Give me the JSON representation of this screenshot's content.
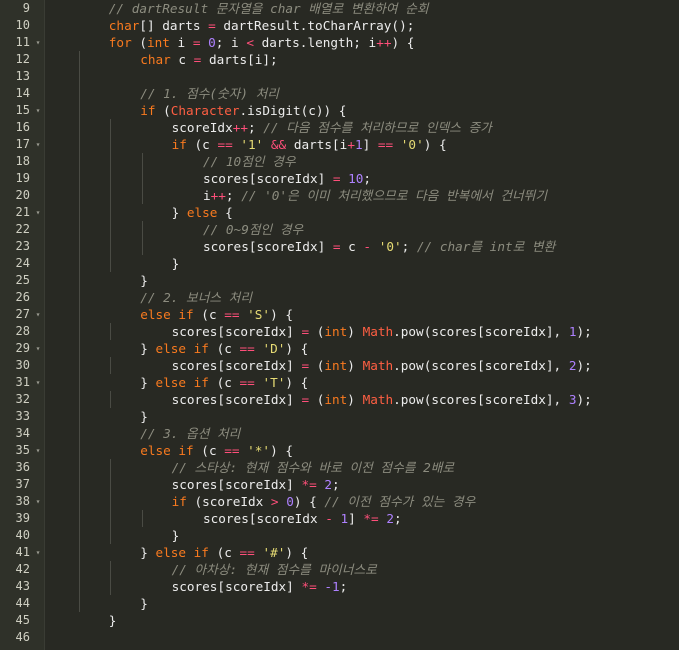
{
  "colors": {
    "background": "#282923",
    "gutter": "#2f3129",
    "line_number": "#cfcfc2",
    "comment": "#8c8c7f",
    "keyword": "#f97a1f",
    "operator": "#ff4f7a",
    "string": "#e6db74",
    "number": "#ae81ff",
    "class_name": "#ff5f43",
    "plain": "#ececec"
  },
  "editor": {
    "lines": [
      {
        "num": "9",
        "fold": "",
        "indent": 2,
        "tokens": [
          {
            "t": "// dartResult 문자열을 char 배열로 변환하여 순회",
            "k": "comment"
          }
        ]
      },
      {
        "num": "10",
        "fold": "",
        "indent": 2,
        "tokens": [
          {
            "t": "char",
            "k": "keyword"
          },
          {
            "t": "[] darts ",
            "k": "plain"
          },
          {
            "t": "=",
            "k": "operator"
          },
          {
            "t": " dartResult.toCharArray();",
            "k": "plain"
          }
        ]
      },
      {
        "num": "11",
        "fold": "▾",
        "indent": 2,
        "tokens": [
          {
            "t": "for",
            "k": "keyword"
          },
          {
            "t": " (",
            "k": "plain"
          },
          {
            "t": "int",
            "k": "keyword"
          },
          {
            "t": " i ",
            "k": "plain"
          },
          {
            "t": "=",
            "k": "operator"
          },
          {
            "t": " ",
            "k": "plain"
          },
          {
            "t": "0",
            "k": "number"
          },
          {
            "t": "; i ",
            "k": "plain"
          },
          {
            "t": "<",
            "k": "operator"
          },
          {
            "t": " darts.length; i",
            "k": "plain"
          },
          {
            "t": "++",
            "k": "operator"
          },
          {
            "t": ") {",
            "k": "plain"
          }
        ]
      },
      {
        "num": "12",
        "fold": "",
        "indent": 3,
        "tokens": [
          {
            "t": "char",
            "k": "keyword"
          },
          {
            "t": " c ",
            "k": "plain"
          },
          {
            "t": "=",
            "k": "operator"
          },
          {
            "t": " darts[i];",
            "k": "plain"
          }
        ]
      },
      {
        "num": "13",
        "fold": "",
        "indent": 3,
        "tokens": []
      },
      {
        "num": "14",
        "fold": "",
        "indent": 3,
        "tokens": [
          {
            "t": "// 1. 점수(숫자) 처리",
            "k": "comment"
          }
        ]
      },
      {
        "num": "15",
        "fold": "▾",
        "indent": 3,
        "tokens": [
          {
            "t": "if",
            "k": "keyword"
          },
          {
            "t": " (",
            "k": "plain"
          },
          {
            "t": "Character",
            "k": "class"
          },
          {
            "t": ".isDigit(c)) {",
            "k": "plain"
          }
        ]
      },
      {
        "num": "16",
        "fold": "",
        "indent": 4,
        "tokens": [
          {
            "t": "scoreIdx",
            "k": "plain"
          },
          {
            "t": "++",
            "k": "operator"
          },
          {
            "t": "; ",
            "k": "plain"
          },
          {
            "t": "// 다음 점수를 처리하므로 인덱스 증가",
            "k": "comment"
          }
        ]
      },
      {
        "num": "17",
        "fold": "▾",
        "indent": 4,
        "tokens": [
          {
            "t": "if",
            "k": "keyword"
          },
          {
            "t": " (c ",
            "k": "plain"
          },
          {
            "t": "==",
            "k": "operator"
          },
          {
            "t": " ",
            "k": "plain"
          },
          {
            "t": "'1'",
            "k": "string"
          },
          {
            "t": " ",
            "k": "plain"
          },
          {
            "t": "&&",
            "k": "operator"
          },
          {
            "t": " darts[i",
            "k": "plain"
          },
          {
            "t": "+",
            "k": "operator"
          },
          {
            "t": "1",
            "k": "number"
          },
          {
            "t": "] ",
            "k": "plain"
          },
          {
            "t": "==",
            "k": "operator"
          },
          {
            "t": " ",
            "k": "plain"
          },
          {
            "t": "'0'",
            "k": "string"
          },
          {
            "t": ") {",
            "k": "plain"
          }
        ]
      },
      {
        "num": "18",
        "fold": "",
        "indent": 5,
        "tokens": [
          {
            "t": "// 10점인 경우",
            "k": "comment"
          }
        ]
      },
      {
        "num": "19",
        "fold": "",
        "indent": 5,
        "tokens": [
          {
            "t": "scores[scoreIdx] ",
            "k": "plain"
          },
          {
            "t": "=",
            "k": "operator"
          },
          {
            "t": " ",
            "k": "plain"
          },
          {
            "t": "10",
            "k": "number"
          },
          {
            "t": ";",
            "k": "plain"
          }
        ]
      },
      {
        "num": "20",
        "fold": "",
        "indent": 5,
        "tokens": [
          {
            "t": "i",
            "k": "plain"
          },
          {
            "t": "++",
            "k": "operator"
          },
          {
            "t": "; ",
            "k": "plain"
          },
          {
            "t": "// '0'은 이미 처리했으므로 다음 반복에서 건너뛰기",
            "k": "comment"
          }
        ]
      },
      {
        "num": "21",
        "fold": "▾",
        "indent": 4,
        "tokens": [
          {
            "t": "} ",
            "k": "plain"
          },
          {
            "t": "else",
            "k": "keyword"
          },
          {
            "t": " {",
            "k": "plain"
          }
        ]
      },
      {
        "num": "22",
        "fold": "",
        "indent": 5,
        "tokens": [
          {
            "t": "// 0~9점인 경우",
            "k": "comment"
          }
        ]
      },
      {
        "num": "23",
        "fold": "",
        "indent": 5,
        "tokens": [
          {
            "t": "scores[scoreIdx] ",
            "k": "plain"
          },
          {
            "t": "=",
            "k": "operator"
          },
          {
            "t": " c ",
            "k": "plain"
          },
          {
            "t": "-",
            "k": "operator"
          },
          {
            "t": " ",
            "k": "plain"
          },
          {
            "t": "'0'",
            "k": "string"
          },
          {
            "t": "; ",
            "k": "plain"
          },
          {
            "t": "// char를 int로 변환",
            "k": "comment"
          }
        ]
      },
      {
        "num": "24",
        "fold": "",
        "indent": 4,
        "tokens": [
          {
            "t": "}",
            "k": "plain"
          }
        ]
      },
      {
        "num": "25",
        "fold": "",
        "indent": 3,
        "tokens": [
          {
            "t": "}",
            "k": "plain"
          }
        ]
      },
      {
        "num": "26",
        "fold": "",
        "indent": 3,
        "tokens": [
          {
            "t": "// 2. 보너스 처리",
            "k": "comment"
          }
        ]
      },
      {
        "num": "27",
        "fold": "▾",
        "indent": 3,
        "tokens": [
          {
            "t": "else",
            "k": "keyword"
          },
          {
            "t": " ",
            "k": "plain"
          },
          {
            "t": "if",
            "k": "keyword"
          },
          {
            "t": " (c ",
            "k": "plain"
          },
          {
            "t": "==",
            "k": "operator"
          },
          {
            "t": " ",
            "k": "plain"
          },
          {
            "t": "'S'",
            "k": "string"
          },
          {
            "t": ") {",
            "k": "plain"
          }
        ]
      },
      {
        "num": "28",
        "fold": "",
        "indent": 4,
        "tokens": [
          {
            "t": "scores[scoreIdx] ",
            "k": "plain"
          },
          {
            "t": "=",
            "k": "operator"
          },
          {
            "t": " (",
            "k": "plain"
          },
          {
            "t": "int",
            "k": "keyword"
          },
          {
            "t": ") ",
            "k": "plain"
          },
          {
            "t": "Math",
            "k": "class"
          },
          {
            "t": ".pow(scores[scoreIdx], ",
            "k": "plain"
          },
          {
            "t": "1",
            "k": "number"
          },
          {
            "t": ");",
            "k": "plain"
          }
        ]
      },
      {
        "num": "29",
        "fold": "▾",
        "indent": 3,
        "tokens": [
          {
            "t": "} ",
            "k": "plain"
          },
          {
            "t": "else",
            "k": "keyword"
          },
          {
            "t": " ",
            "k": "plain"
          },
          {
            "t": "if",
            "k": "keyword"
          },
          {
            "t": " (c ",
            "k": "plain"
          },
          {
            "t": "==",
            "k": "operator"
          },
          {
            "t": " ",
            "k": "plain"
          },
          {
            "t": "'D'",
            "k": "string"
          },
          {
            "t": ") {",
            "k": "plain"
          }
        ]
      },
      {
        "num": "30",
        "fold": "",
        "indent": 4,
        "tokens": [
          {
            "t": "scores[scoreIdx] ",
            "k": "plain"
          },
          {
            "t": "=",
            "k": "operator"
          },
          {
            "t": " (",
            "k": "plain"
          },
          {
            "t": "int",
            "k": "keyword"
          },
          {
            "t": ") ",
            "k": "plain"
          },
          {
            "t": "Math",
            "k": "class"
          },
          {
            "t": ".pow(scores[scoreIdx], ",
            "k": "plain"
          },
          {
            "t": "2",
            "k": "number"
          },
          {
            "t": ");",
            "k": "plain"
          }
        ]
      },
      {
        "num": "31",
        "fold": "▾",
        "indent": 3,
        "tokens": [
          {
            "t": "} ",
            "k": "plain"
          },
          {
            "t": "else",
            "k": "keyword"
          },
          {
            "t": " ",
            "k": "plain"
          },
          {
            "t": "if",
            "k": "keyword"
          },
          {
            "t": " (c ",
            "k": "plain"
          },
          {
            "t": "==",
            "k": "operator"
          },
          {
            "t": " ",
            "k": "plain"
          },
          {
            "t": "'T'",
            "k": "string"
          },
          {
            "t": ") {",
            "k": "plain"
          }
        ]
      },
      {
        "num": "32",
        "fold": "",
        "indent": 4,
        "tokens": [
          {
            "t": "scores[scoreIdx] ",
            "k": "plain"
          },
          {
            "t": "=",
            "k": "operator"
          },
          {
            "t": " (",
            "k": "plain"
          },
          {
            "t": "int",
            "k": "keyword"
          },
          {
            "t": ") ",
            "k": "plain"
          },
          {
            "t": "Math",
            "k": "class"
          },
          {
            "t": ".pow(scores[scoreIdx], ",
            "k": "plain"
          },
          {
            "t": "3",
            "k": "number"
          },
          {
            "t": ");",
            "k": "plain"
          }
        ]
      },
      {
        "num": "33",
        "fold": "",
        "indent": 3,
        "tokens": [
          {
            "t": "}",
            "k": "plain"
          }
        ]
      },
      {
        "num": "34",
        "fold": "",
        "indent": 3,
        "tokens": [
          {
            "t": "// 3. 옵션 처리",
            "k": "comment"
          }
        ]
      },
      {
        "num": "35",
        "fold": "▾",
        "indent": 3,
        "tokens": [
          {
            "t": "else",
            "k": "keyword"
          },
          {
            "t": " ",
            "k": "plain"
          },
          {
            "t": "if",
            "k": "keyword"
          },
          {
            "t": " (c ",
            "k": "plain"
          },
          {
            "t": "==",
            "k": "operator"
          },
          {
            "t": " ",
            "k": "plain"
          },
          {
            "t": "'*'",
            "k": "string"
          },
          {
            "t": ") {",
            "k": "plain"
          }
        ]
      },
      {
        "num": "36",
        "fold": "",
        "indent": 4,
        "tokens": [
          {
            "t": "// 스타상: 현재 점수와 바로 이전 점수를 2배로",
            "k": "comment"
          }
        ]
      },
      {
        "num": "37",
        "fold": "",
        "indent": 4,
        "tokens": [
          {
            "t": "scores[scoreIdx] ",
            "k": "plain"
          },
          {
            "t": "*=",
            "k": "operator"
          },
          {
            "t": " ",
            "k": "plain"
          },
          {
            "t": "2",
            "k": "number"
          },
          {
            "t": ";",
            "k": "plain"
          }
        ]
      },
      {
        "num": "38",
        "fold": "▾",
        "indent": 4,
        "tokens": [
          {
            "t": "if",
            "k": "keyword"
          },
          {
            "t": " (scoreIdx ",
            "k": "plain"
          },
          {
            "t": ">",
            "k": "operator"
          },
          {
            "t": " ",
            "k": "plain"
          },
          {
            "t": "0",
            "k": "number"
          },
          {
            "t": ") { ",
            "k": "plain"
          },
          {
            "t": "// 이전 점수가 있는 경우",
            "k": "comment"
          }
        ]
      },
      {
        "num": "39",
        "fold": "",
        "indent": 5,
        "tokens": [
          {
            "t": "scores[scoreIdx ",
            "k": "plain"
          },
          {
            "t": "-",
            "k": "operator"
          },
          {
            "t": " ",
            "k": "plain"
          },
          {
            "t": "1",
            "k": "number"
          },
          {
            "t": "] ",
            "k": "plain"
          },
          {
            "t": "*=",
            "k": "operator"
          },
          {
            "t": " ",
            "k": "plain"
          },
          {
            "t": "2",
            "k": "number"
          },
          {
            "t": ";",
            "k": "plain"
          }
        ]
      },
      {
        "num": "40",
        "fold": "",
        "indent": 4,
        "tokens": [
          {
            "t": "}",
            "k": "plain"
          }
        ]
      },
      {
        "num": "41",
        "fold": "▾",
        "indent": 3,
        "tokens": [
          {
            "t": "} ",
            "k": "plain"
          },
          {
            "t": "else",
            "k": "keyword"
          },
          {
            "t": " ",
            "k": "plain"
          },
          {
            "t": "if",
            "k": "keyword"
          },
          {
            "t": " (c ",
            "k": "plain"
          },
          {
            "t": "==",
            "k": "operator"
          },
          {
            "t": " ",
            "k": "plain"
          },
          {
            "t": "'#'",
            "k": "string"
          },
          {
            "t": ") {",
            "k": "plain"
          }
        ]
      },
      {
        "num": "42",
        "fold": "",
        "indent": 4,
        "tokens": [
          {
            "t": "// 아차상: 현재 점수를 마이너스로",
            "k": "comment"
          }
        ]
      },
      {
        "num": "43",
        "fold": "",
        "indent": 4,
        "tokens": [
          {
            "t": "scores[scoreIdx] ",
            "k": "plain"
          },
          {
            "t": "*=",
            "k": "operator"
          },
          {
            "t": " ",
            "k": "plain"
          },
          {
            "t": "-1",
            "k": "number"
          },
          {
            "t": ";",
            "k": "plain"
          }
        ]
      },
      {
        "num": "44",
        "fold": "",
        "indent": 3,
        "tokens": [
          {
            "t": "}",
            "k": "plain"
          }
        ]
      },
      {
        "num": "45",
        "fold": "",
        "indent": 2,
        "tokens": [
          {
            "t": "}",
            "k": "plain"
          }
        ]
      },
      {
        "num": "46",
        "fold": "",
        "indent": 2,
        "tokens": []
      }
    ]
  }
}
